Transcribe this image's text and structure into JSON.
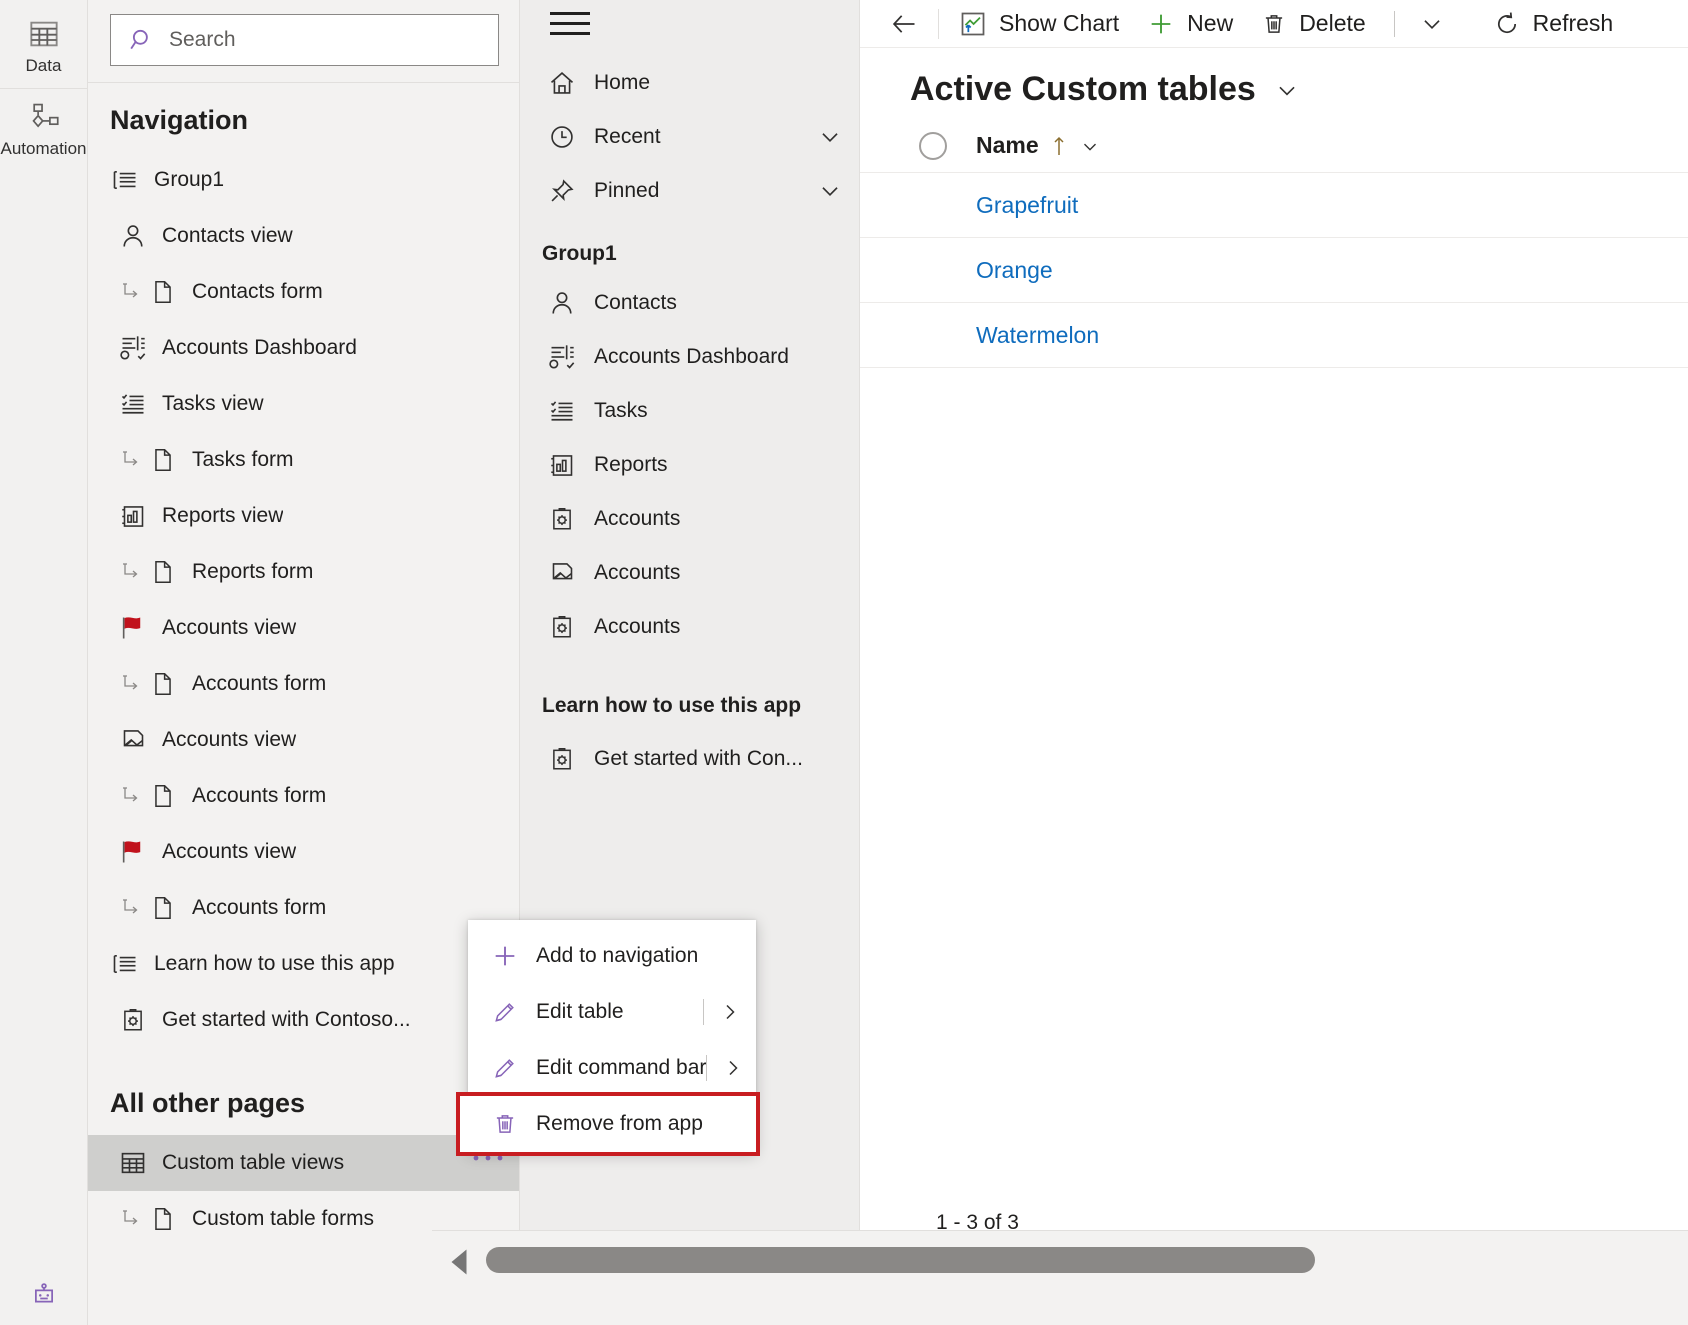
{
  "rail": {
    "items": [
      {
        "label": "Data",
        "icon": "table-icon"
      },
      {
        "label": "Automation",
        "icon": "flow-icon"
      }
    ],
    "bottom_icon": "bot-icon"
  },
  "search": {
    "placeholder": "Search",
    "value": "",
    "icon": "search-icon"
  },
  "navigation": {
    "title": "Navigation",
    "items": [
      {
        "label": "Group1",
        "icon": "group-list-icon",
        "level": 0,
        "sub": false
      },
      {
        "label": "Contacts view",
        "icon": "contact-icon",
        "level": 1,
        "sub": false
      },
      {
        "label": "Contacts form",
        "icon": "form-page-icon",
        "level": 2,
        "sub": true
      },
      {
        "label": "Accounts Dashboard",
        "icon": "dashboard-icon",
        "level": 1,
        "sub": false
      },
      {
        "label": "Tasks view",
        "icon": "task-list-icon",
        "level": 1,
        "sub": false
      },
      {
        "label": "Tasks form",
        "icon": "form-page-icon",
        "level": 2,
        "sub": true
      },
      {
        "label": "Reports view",
        "icon": "report-chart-icon",
        "level": 1,
        "sub": false
      },
      {
        "label": "Reports form",
        "icon": "form-page-icon",
        "level": 2,
        "sub": true
      },
      {
        "label": "Accounts view",
        "icon": "red-flag-icon",
        "level": 1,
        "sub": false
      },
      {
        "label": "Accounts form",
        "icon": "form-page-icon",
        "level": 2,
        "sub": true
      },
      {
        "label": "Accounts view",
        "icon": "folder-card-icon",
        "level": 1,
        "sub": false
      },
      {
        "label": "Accounts form",
        "icon": "form-page-icon",
        "level": 2,
        "sub": true
      },
      {
        "label": "Accounts view",
        "icon": "red-flag-icon",
        "level": 1,
        "sub": false
      },
      {
        "label": "Accounts form",
        "icon": "form-page-icon",
        "level": 2,
        "sub": true
      },
      {
        "label": "Learn how to use this app",
        "icon": "group-list-icon",
        "level": 0,
        "sub": false
      },
      {
        "label": "Get started with Contoso...",
        "icon": "clipboard-gear-icon",
        "level": 1,
        "sub": false
      }
    ],
    "all_other_pages_title": "All other pages",
    "other_pages": [
      {
        "label": "Custom table views",
        "icon": "table-grid-icon",
        "selected": true,
        "menu_icon": "more-ellipsis-icon"
      },
      {
        "label": "Custom table forms",
        "icon": "form-page-icon",
        "selected": false,
        "sub": true
      }
    ]
  },
  "preview": {
    "hamburger_icon": "hamburger-icon",
    "top_items": [
      {
        "label": "Home",
        "icon": "home-icon",
        "chevron": false
      },
      {
        "label": "Recent",
        "icon": "clock-icon",
        "chevron": true
      },
      {
        "label": "Pinned",
        "icon": "pin-icon",
        "chevron": true
      }
    ],
    "group_title": "Group1",
    "group_items": [
      {
        "label": "Contacts",
        "icon": "contact-icon"
      },
      {
        "label": "Accounts Dashboard",
        "icon": "dashboard-icon"
      },
      {
        "label": "Tasks",
        "icon": "task-list-icon"
      },
      {
        "label": "Reports",
        "icon": "report-chart-icon"
      },
      {
        "label": "Accounts",
        "icon": "clipboard-gear-icon"
      },
      {
        "label": "Accounts",
        "icon": "folder-card-icon"
      },
      {
        "label": "Accounts",
        "icon": "clipboard-gear-icon"
      }
    ],
    "learn_title": "Learn how to use this app",
    "learn_items": [
      {
        "label": "Get started with Con...",
        "icon": "clipboard-gear-icon"
      }
    ]
  },
  "commandbar": {
    "back_icon": "arrow-left-icon",
    "buttons": [
      {
        "label": "Show Chart",
        "icon": "show-chart-icon"
      },
      {
        "label": "New",
        "icon": "plus-icon"
      },
      {
        "label": "Delete",
        "icon": "trash-icon"
      }
    ],
    "overflow_icon": "chevron-down-icon",
    "refresh": {
      "label": "Refresh",
      "icon": "refresh-icon"
    }
  },
  "view": {
    "title": "Active Custom tables",
    "title_chevron_icon": "chevron-down-icon",
    "columns": [
      {
        "label": "Name",
        "sort_icon": "sort-asc-arrow-icon",
        "menu_icon": "chevron-down-icon"
      }
    ],
    "rows": [
      {
        "name": "Grapefruit"
      },
      {
        "name": "Orange"
      },
      {
        "name": "Watermelon"
      }
    ],
    "pagination": "1 - 3 of 3"
  },
  "context_menu": {
    "items": [
      {
        "label": "Add to navigation",
        "icon": "plus-icon",
        "submenu": false,
        "highlight": false
      },
      {
        "label": "Edit table",
        "icon": "pencil-icon",
        "submenu": true,
        "highlight": false
      },
      {
        "label": "Edit command bar",
        "icon": "pencil-icon",
        "submenu": true,
        "highlight": false
      },
      {
        "label": "Remove from app",
        "icon": "trash-icon",
        "submenu": false,
        "highlight": true
      }
    ]
  },
  "scrollbar": {
    "left_arrow_icon": "triangle-left-icon"
  },
  "colors": {
    "accent_purple": "#8764b8",
    "link_blue": "#0f6cbd",
    "highlight_red": "#c81d21",
    "flag_red": "#c1121c",
    "green": "#3f9c35"
  }
}
